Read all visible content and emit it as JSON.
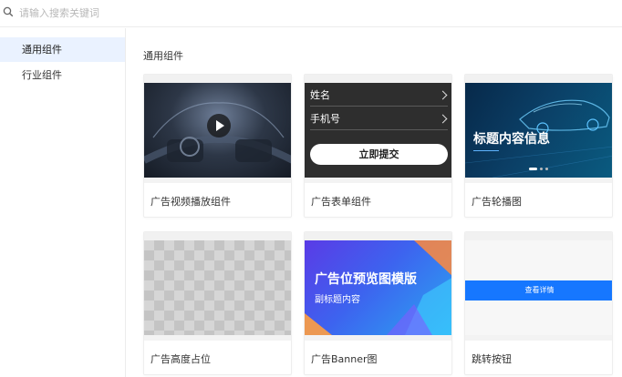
{
  "search": {
    "placeholder": "请输入搜索关键词"
  },
  "sidebar": {
    "items": [
      {
        "label": "通用组件",
        "active": true
      },
      {
        "label": "行业组件",
        "active": false
      }
    ]
  },
  "main": {
    "section_title": "通用组件",
    "cards": [
      {
        "name": "广告视频播放组件"
      },
      {
        "name": "广告表单组件",
        "form": {
          "field1": "姓名",
          "field2": "手机号",
          "submit": "立即提交"
        }
      },
      {
        "name": "广告轮播图",
        "carousel_title": "标题内容信息"
      },
      {
        "name": "广告高度占位"
      },
      {
        "name": "广告Banner图",
        "banner_title": "广告位预览图模版",
        "banner_subtitle": "副标题内容"
      },
      {
        "name": "跳转按钮",
        "button_label": "查看详情"
      }
    ]
  },
  "colors": {
    "accent": "#1677ff",
    "active_bg": "#eaf2ff"
  }
}
